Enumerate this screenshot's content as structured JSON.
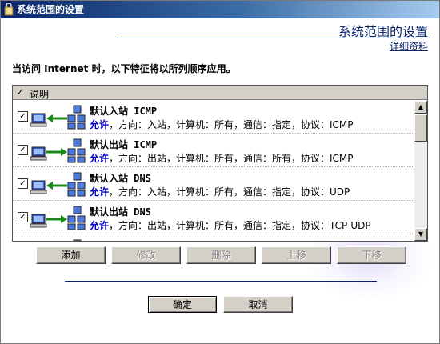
{
  "window": {
    "title": "系统范围的设置"
  },
  "header": {
    "title": "系统范围的设置",
    "link": "详细资料"
  },
  "intro_text": "当访问 Internet 时，以下特征将以所列顺序应用。",
  "list": {
    "column_header": "说明",
    "items": [
      {
        "name": "默认入站 ICMP",
        "allow": "允许",
        "desc": "，方向：入站，计算机：所有，通信：指定，协议：ICMP",
        "checked": true,
        "direction": "in"
      },
      {
        "name": "默认出站 ICMP",
        "allow": "允许",
        "desc": "，方向：出站，计算机：所有，通信：所有，协议：ICMP",
        "checked": true,
        "direction": "out"
      },
      {
        "name": "默认入站 DNS",
        "allow": "允许",
        "desc": "，方向：入站，计算机：所有，通信：指定，协议：UDP",
        "checked": true,
        "direction": "in"
      },
      {
        "name": "默认出站 DNS",
        "allow": "允许",
        "desc": "，方向：出站，计算机：所有，通信：指定，协议：TCP-UDP",
        "checked": true,
        "direction": "out"
      }
    ]
  },
  "buttons": {
    "add": "添加",
    "edit": "修改",
    "delete": "删除",
    "move_up": "上移",
    "move_down": "下移",
    "ok": "确定",
    "cancel": "取消"
  },
  "colors": {
    "title_bar": "#0a246a",
    "link": "#0a246a",
    "allow": "#0000cc",
    "arrow": "#1a8a1a"
  }
}
